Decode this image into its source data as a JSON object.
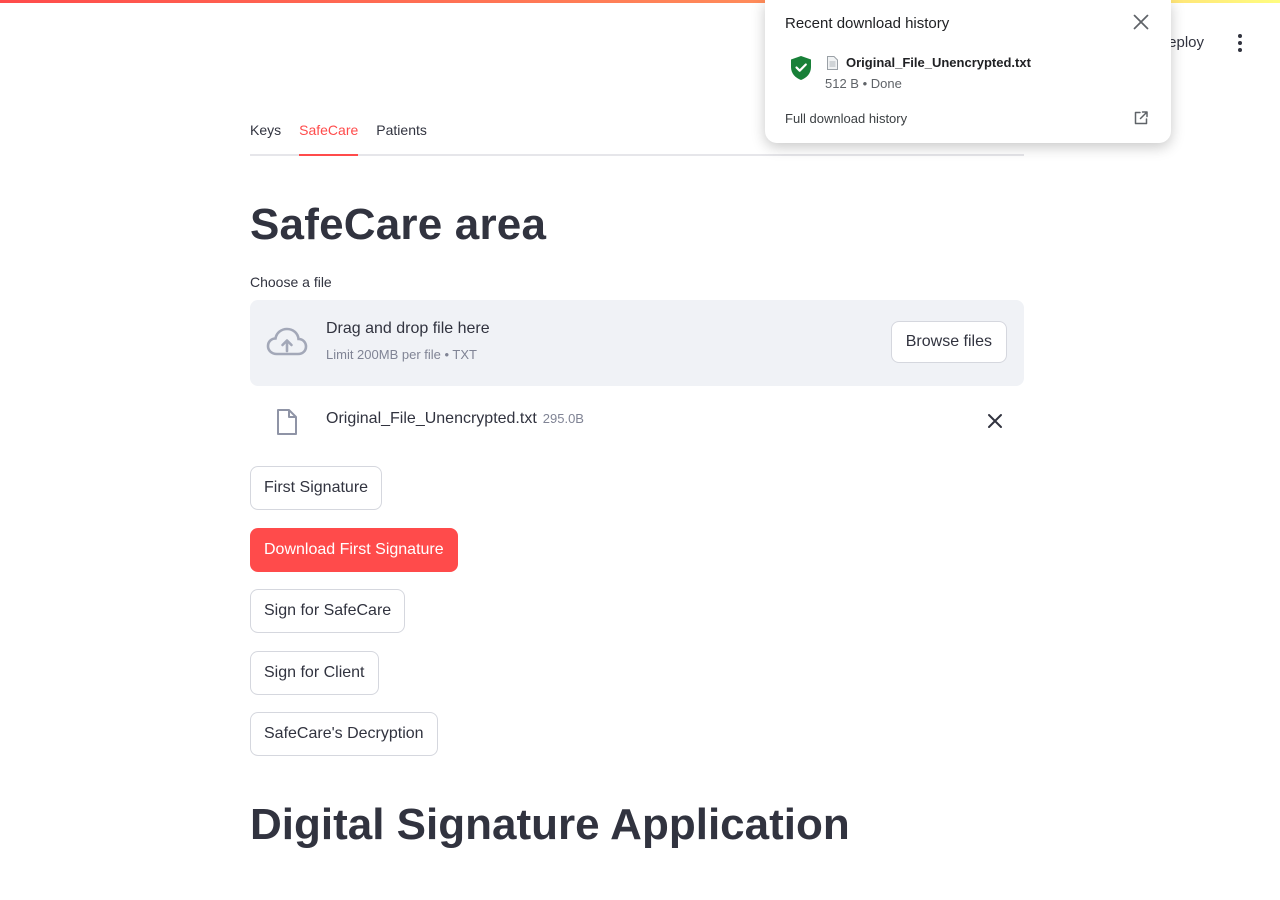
{
  "header": {
    "deploy_label": "eploy"
  },
  "tabs": [
    {
      "label": "Keys",
      "active": false
    },
    {
      "label": "SafeCare",
      "active": true
    },
    {
      "label": "Patients",
      "active": false
    }
  ],
  "page_title": "SafeCare area",
  "uploader": {
    "label": "Choose a file",
    "drop_text": "Drag and drop file here",
    "limit_text": "Limit 200MB per file • TXT",
    "browse_label": "Browse files",
    "file_name": "Original_File_Unencrypted.txt",
    "file_size": "295.0B"
  },
  "buttons": {
    "first_signature": "First Signature",
    "download_first_signature": "Download First Signature",
    "sign_safecare": "Sign for SafeCare",
    "sign_client": "Sign for Client",
    "safecare_decryption": "SafeCare's Decryption"
  },
  "section_title": "Digital Signature Application",
  "download_popup": {
    "title": "Recent download history",
    "file_name": "Original_File_Unencrypted.txt",
    "status": "512 B • Done",
    "full_history_label": "Full download history"
  },
  "colors": {
    "accent": "#ff4b4b",
    "text": "#31333f",
    "shield_green": "#188038"
  }
}
